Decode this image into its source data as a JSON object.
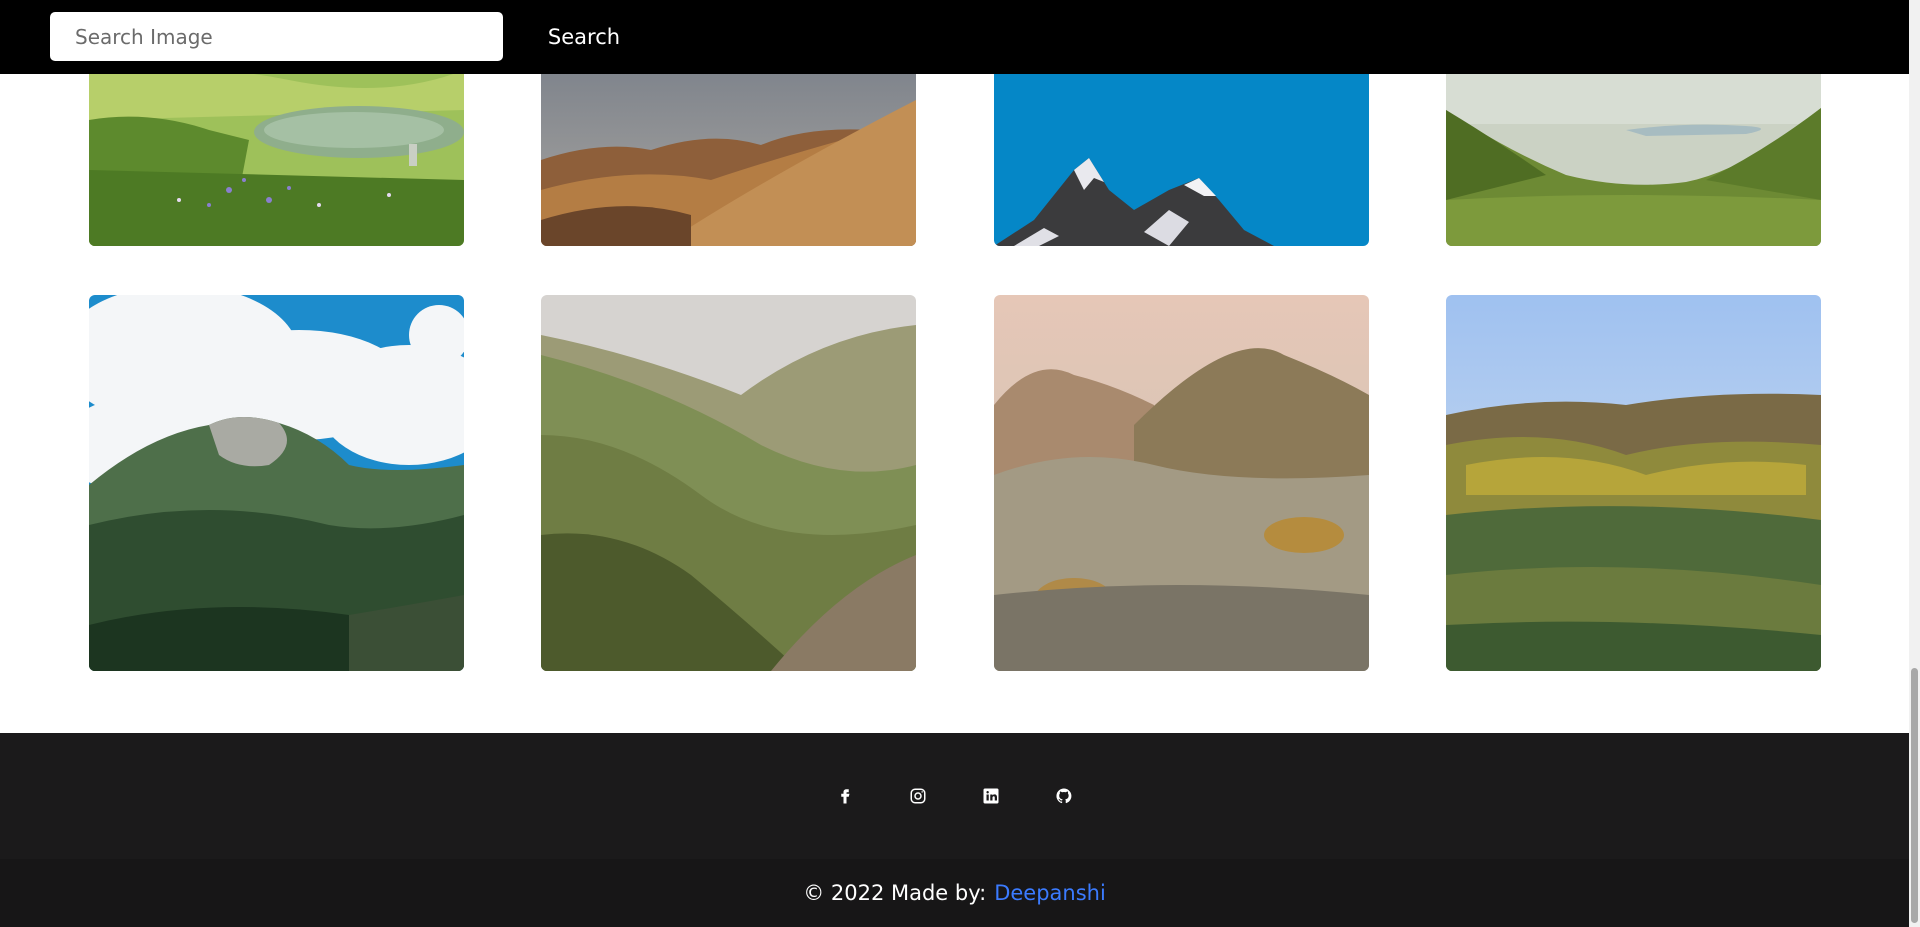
{
  "header": {
    "search_placeholder": "Search Image",
    "search_button_label": "Search"
  },
  "gallery": {
    "images": [
      {
        "name": "alpine-meadow-lake"
      },
      {
        "name": "brown-rolling-hills"
      },
      {
        "name": "snowy-peaks-blue-sky"
      },
      {
        "name": "green-valley-coast"
      },
      {
        "name": "forested-mountain-clouds"
      },
      {
        "name": "green-rolling-hills"
      },
      {
        "name": "hazy-hills-sunset"
      },
      {
        "name": "hills-blue-sky-wildflowers"
      }
    ]
  },
  "footer": {
    "social_icons": [
      "facebook-icon",
      "instagram-icon",
      "linkedin-icon",
      "github-icon"
    ],
    "copyright_text": "© 2022 Made by:",
    "author_name": "Deepanshi",
    "author_link_color": "#3b7bff"
  },
  "colors": {
    "topbar_bg": "#000000",
    "footer_bg": "#1b1a1b",
    "copyright_bg": "#171617"
  }
}
